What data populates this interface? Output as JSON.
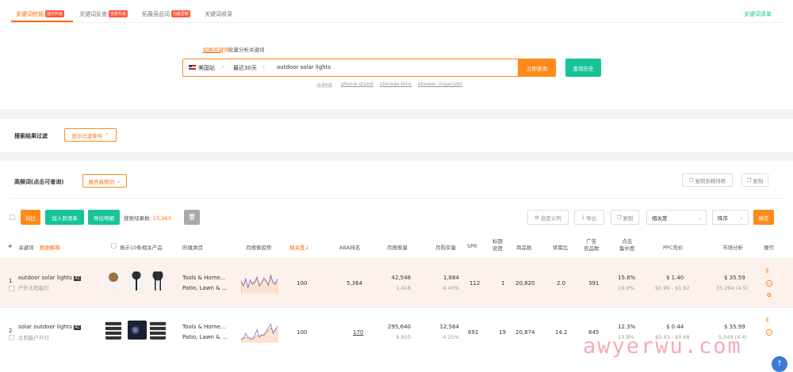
{
  "tabs": [
    {
      "label": "关键词挖掘",
      "badge": "插件升级"
    },
    {
      "label": "关键词反查",
      "badge": "全新升级"
    },
    {
      "label": "拓展竞品词",
      "badge": "功能更新"
    },
    {
      "label": "关键词收录",
      "badge": ""
    }
  ],
  "top_right_link": "关键词清单",
  "search": {
    "mode_tabs": [
      "挖掘关键词",
      "批量分析关键词"
    ],
    "site": "美国站",
    "period": "最近30天",
    "query": "outdoor solar lights",
    "search_button": "立即查询",
    "history_button": "查询历史",
    "example_label": "示例词:",
    "examples": [
      "phone stand",
      "storage bins",
      "shower organizer"
    ]
  },
  "filter": {
    "title": "搜索结果过滤",
    "toggle": "显示过滤条件"
  },
  "freq": {
    "title": "高频词(点击可查询)",
    "toggle": "展开高频词",
    "copy_to_rank": "复制到精排框",
    "copy": "复制"
  },
  "toolbar": {
    "compare": "对比",
    "add_to_list": "加入到清单",
    "export": "导出明细",
    "result_label": "搜索结果数:",
    "result_count": "13,363",
    "custom_cols": "自定义列",
    "import": "导出",
    "copy": "复制",
    "sort_field": "相关度",
    "sort_order": "降序",
    "confirm": "确定"
  },
  "columns": {
    "idx": "#",
    "keyword": "关键词",
    "data_explain": "数据解释",
    "products": "展示10条相关产品",
    "category": "所属类目",
    "trend": "月搜索趋势",
    "relevance": "相关度",
    "aba": "ABA排名",
    "monthly_search": "月搜索量",
    "monthly_purchase": "月购买量",
    "spr": "SPR",
    "title_density": [
      "标题",
      "密度"
    ],
    "product_count": "商品数",
    "supply_ratio": "供需比",
    "ad_products": [
      "广告",
      "竞品数"
    ],
    "click_concentration": [
      "点击",
      "集中度"
    ],
    "ppc": "PPC竞价",
    "market": "市场分析",
    "ops": "操作"
  },
  "rows": [
    {
      "idx": "1",
      "keyword": "outdoor solar lights",
      "tag": "AC",
      "translation": "户外太阳能灯",
      "category_1": "Tools & Home...",
      "category_2": "Patio, Lawn & ...",
      "relevance": "100",
      "aba": "5,364",
      "monthly_search": "42,548",
      "monthly_search_sub": "1,418",
      "monthly_purchase": "1,884",
      "monthly_purchase_sub": "4.43%",
      "spr": "112",
      "title_density": "1",
      "product_count": "20,820",
      "supply_ratio": "2.0",
      "ad_products": "391",
      "click_conc": "15.8%",
      "click_conc_sub": "19.9%",
      "ppc": "$ 1.40",
      "ppc_range": "$0.99 - $1.92",
      "market": "$ 35.59",
      "market_sub": "35,294 (4.5)",
      "trend_blue": [
        0.6,
        0.3,
        0.7,
        0.2,
        0.65,
        0.4,
        0.55,
        0.8,
        0.3,
        0.5,
        0.75,
        0.6,
        0.35,
        0.9,
        0.5,
        0.4,
        0.7
      ],
      "trend_orange": [
        0.5,
        0.4,
        0.6,
        0.3,
        0.55,
        0.5,
        0.45,
        0.7,
        0.4,
        0.45,
        0.65,
        0.55,
        0.4,
        0.8,
        0.45,
        0.5,
        0.6
      ]
    },
    {
      "idx": "2",
      "keyword": "solar outdoor lights",
      "tag": "AC",
      "translation": "太阳能户外灯",
      "category_1": "Tools & Home...",
      "category_2": "Patio, Lawn & ...",
      "relevance": "100",
      "aba": "170",
      "monthly_search": "295,640",
      "monthly_search_sub": "9,855",
      "monthly_purchase": "12,564",
      "monthly_purchase_sub": "4.25%",
      "spr": "691",
      "title_density": "19",
      "product_count": "20,874",
      "supply_ratio": "14.2",
      "ad_products": "845",
      "click_conc": "12.3%",
      "click_conc_sub": "13.9%",
      "ppc": "$ 0.44",
      "ppc_range": "$0.43 - $0.68",
      "market": "$ 35.99",
      "market_sub": "5,549 (4.4)",
      "trend_blue": [
        0.1,
        0.15,
        0.4,
        0.2,
        0.15,
        0.1,
        0.3,
        0.6,
        0.2,
        0.35,
        0.3,
        0.5,
        0.7,
        0.9,
        0.4,
        0.6,
        0.8
      ],
      "trend_orange": [
        0.1,
        0.12,
        0.2,
        0.15,
        0.12,
        0.1,
        0.2,
        0.3,
        0.25,
        0.3,
        0.35,
        0.45,
        0.55,
        0.7,
        0.5,
        0.6,
        0.65
      ]
    }
  ],
  "watermark": "awyerwu.com",
  "colors": {
    "accent": "#ff6a00",
    "green": "#19c39a",
    "row_highlight": "#fdf1ec"
  }
}
